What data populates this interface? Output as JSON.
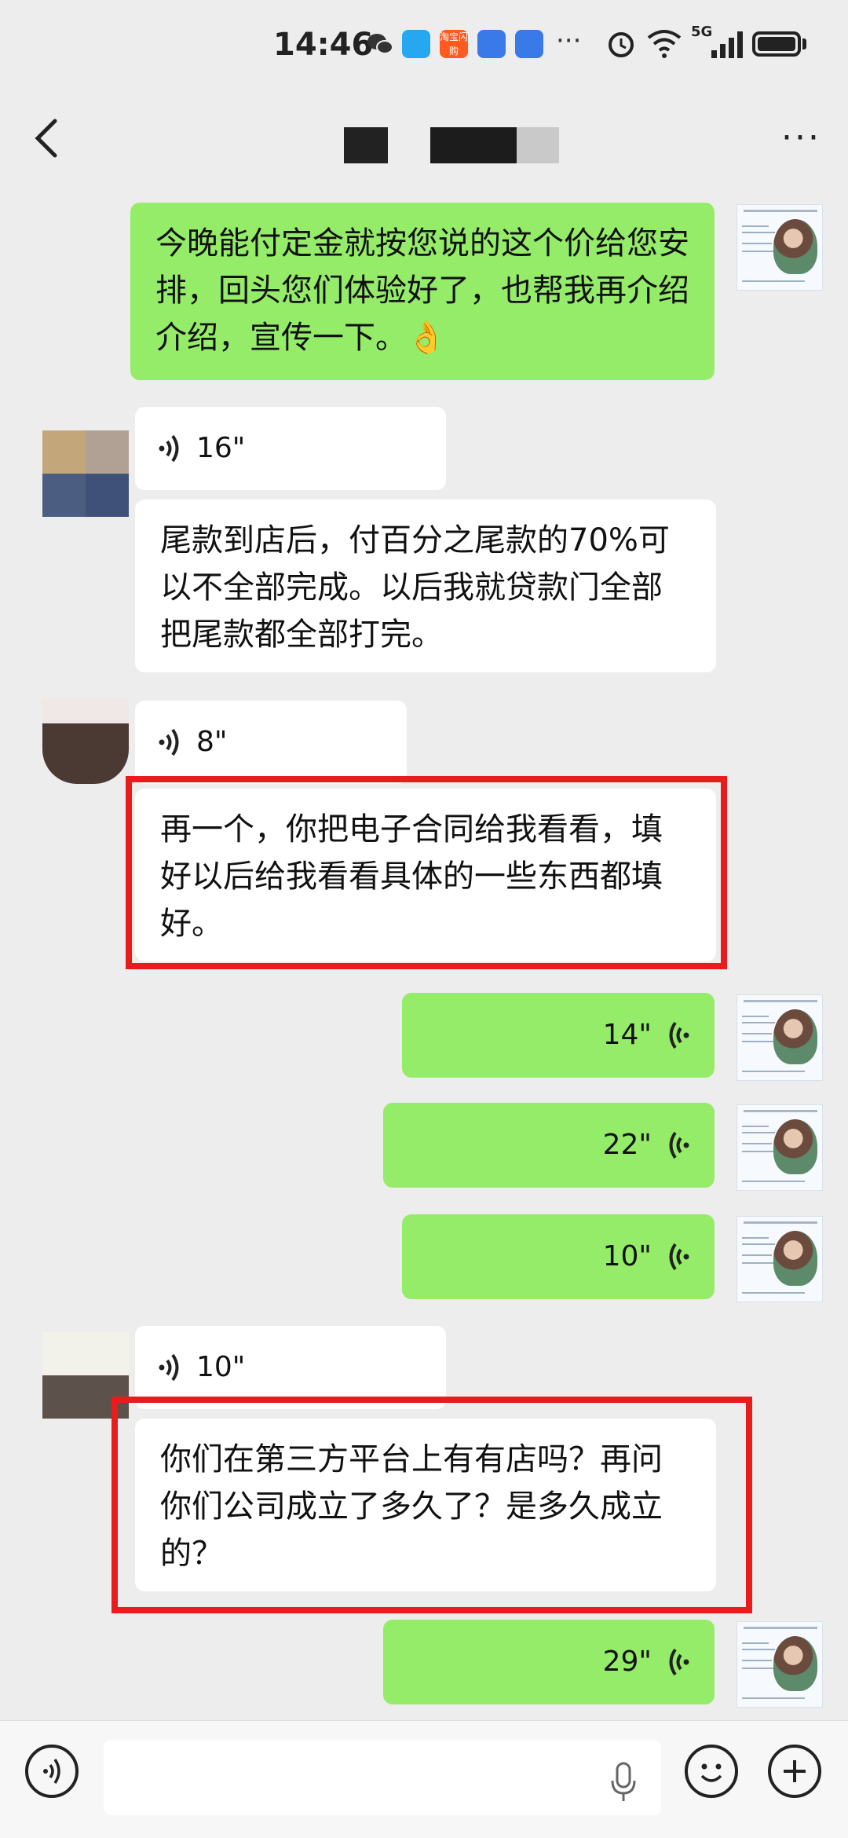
{
  "status_bar": {
    "time": "14:46",
    "network": "5G",
    "more_indicator": "···",
    "icons": [
      "wechat-icon",
      "book-icon",
      "taobao-icon",
      "shield-icon",
      "shield-icon",
      "alarm-icon",
      "wifi-icon",
      "signal-icon",
      "battery-icon"
    ],
    "taobao_label": "淘宝闪购"
  },
  "header": {
    "back_icon": "chevron-left-icon",
    "menu": "···"
  },
  "messages": {
    "m1": "今晚能付定金就按您说的这个价给您安排，回头您们体验好了，也帮我再介绍介绍，宣传一下。👌",
    "m2_duration": "16\"",
    "m3": "尾款到店后，付百分之尾款的70%可以不全部完成。以后我就贷款门全部把尾款都全部打完。",
    "m4_duration": "8\"",
    "m5": "再一个，你把电子合同给我看看，填好以后给我看看具体的一些东西都填好。",
    "m6_duration": "14\"",
    "m7_duration": "22\"",
    "m8_duration": "10\"",
    "m9_duration": "10\"",
    "m10": "你们在第三方平台上有有店吗？再问你们公司成立了多久了？是多久成立的？",
    "m11_duration": "29\""
  },
  "colors": {
    "outgoing": "#95ec69",
    "incoming": "#ffffff",
    "highlight": "#e81c1c",
    "background": "#ededed"
  },
  "input_bar": {
    "left_icon": "voice-mode-icon",
    "mic_icon": "microphone-icon",
    "emoji_icon": "emoji-icon",
    "plus_icon": "plus-icon"
  }
}
